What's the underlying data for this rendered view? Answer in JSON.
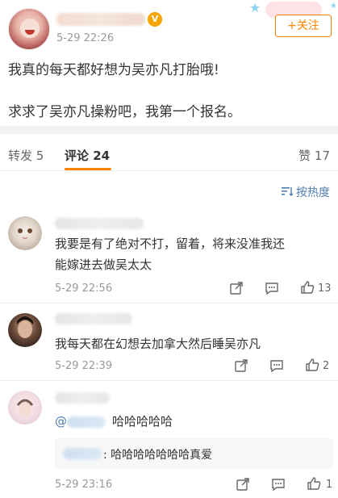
{
  "post": {
    "time": "5-29 22:26",
    "follow_label": "+关注",
    "vip_glyph": "V",
    "line1": "我真的每天都好想为吴亦凡打胎哦!",
    "line2": "求求了吴亦凡操粉吧，我第一个报名。"
  },
  "tabs": {
    "repost": "转发 5",
    "comments": "评论 24",
    "likes": "赞 17"
  },
  "sort": {
    "icon": "sort-icon",
    "label": "按热度"
  },
  "comments": [
    {
      "text_line1": "我要是有了绝对不打，留着，将来没准我还",
      "text_line2": "能嫁进去做吴太太",
      "time": "5-29 22:56",
      "likes": "13"
    },
    {
      "text_line1": "我每天都在幻想去加拿大然后睡吴亦凡",
      "time": "5-29 22:39",
      "likes": "2"
    },
    {
      "mention_at": "@",
      "text_line1": "哈哈哈哈哈",
      "reply_text": ": 哈哈哈哈哈哈哈真爱",
      "time": "5-29 23:16",
      "likes": "1"
    }
  ],
  "icons": {
    "repost": "share-icon",
    "comment": "comment-icon",
    "like": "thumbs-up-icon"
  },
  "colors": {
    "accent": "#ff8200",
    "link": "#507daf",
    "muted": "#999999"
  }
}
